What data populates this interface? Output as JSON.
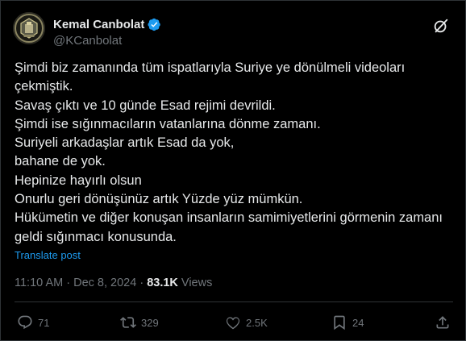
{
  "author": {
    "display_name": "Kemal Canbolat",
    "handle": "@KCanbolat",
    "verified": true,
    "avatar_icon": "avatar-badge-icon"
  },
  "post": {
    "lines": [
      "Şimdi biz zamanında tüm ispatlarıyla Suriye ye dönülmeli videoları",
      "çekmiştik.",
      "Savaş çıktı ve 10 günde Esad rejimi devrildi.",
      "Şimdi ise sığınmacıların vatanlarına dönme zamanı.",
      "Suriyeli arkadaşlar artık Esad da yok,",
      "bahane de yok.",
      "Hepinize hayırlı olsun",
      "Onurlu geri dönüşünüz artık Yüzde yüz mümkün.",
      "Hükümetin ve diğer konuşan insanların samimiyetlerini görmenin zamanı",
      "geldi sığınmacı konusunda."
    ],
    "translate_label": "Translate post"
  },
  "meta": {
    "time": "11:10 AM",
    "separator": " · ",
    "date": "Dec 8, 2024",
    "views_count": "83.1K",
    "views_label": "Views"
  },
  "actions": {
    "replies": "71",
    "reposts": "329",
    "likes": "2.5K",
    "bookmarks": "24"
  },
  "colors": {
    "background": "#000000",
    "text": "#e7e9ea",
    "secondary": "#71767b",
    "link": "#1d9bf0",
    "border": "#2f3336"
  }
}
